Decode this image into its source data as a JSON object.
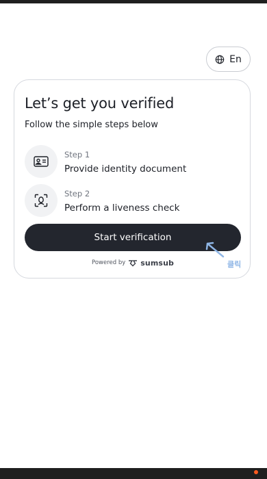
{
  "language": {
    "label": "En",
    "icon": "globe-icon"
  },
  "card": {
    "title": "Let’s get you verified",
    "subtitle": "Follow the simple steps below",
    "steps": [
      {
        "label": "Step 1",
        "text": "Provide identity document",
        "icon": "id-card-icon"
      },
      {
        "label": "Step 2",
        "text": "Perform a liveness check",
        "icon": "face-scan-icon"
      }
    ],
    "start_label": "Start verification",
    "powered_by": "Powered by",
    "brand": "sumsub"
  },
  "overlay": {
    "click_label": "클릭"
  },
  "colors": {
    "button_bg": "#23262e",
    "icon_circle_bg": "#f1f2f4",
    "accent_overlay": "#8fb6e6",
    "notification_dot": "#ff5a1f"
  }
}
